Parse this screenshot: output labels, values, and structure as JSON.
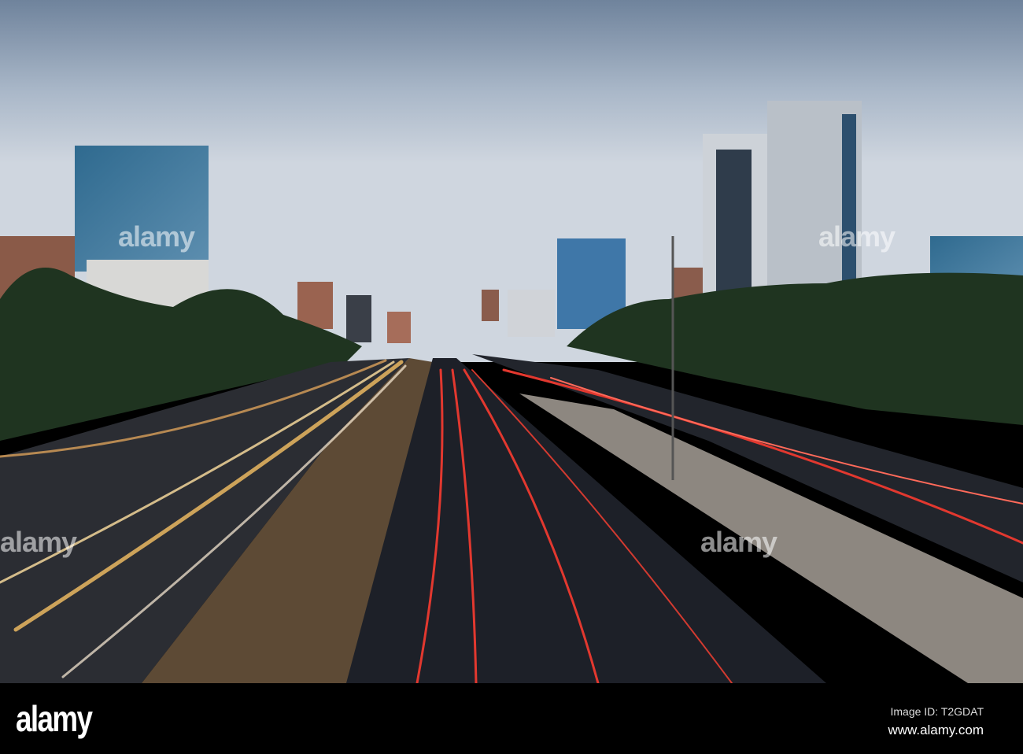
{
  "photo": {
    "subject": "Long-exposure highway with light trails between city buildings at dusk"
  },
  "watermark": {
    "logo": "alamy"
  },
  "footer": {
    "logo": "alamy",
    "image_id": "Image ID: T2GDAT",
    "url": "www.alamy.com"
  },
  "colors": {
    "sky": "#b9c4d3",
    "road": "#1d2028",
    "trail_red": "#e2382f",
    "trail_yellow": "#f6c064",
    "trees": "#1f3420"
  }
}
